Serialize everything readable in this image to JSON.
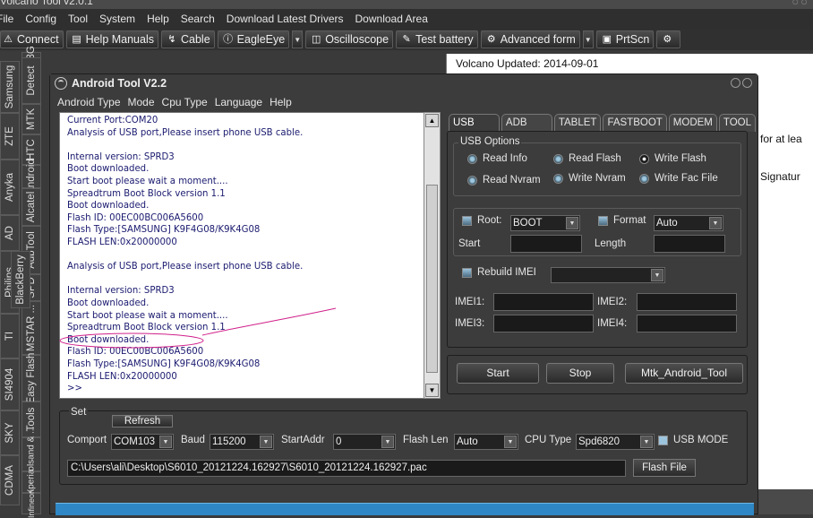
{
  "outer_window": {
    "title": "Volcano Tool v2.0.1",
    "menu": [
      "File",
      "Config",
      "Tool",
      "System",
      "Help",
      "Search",
      "Download Latest Drivers",
      "Download Area"
    ],
    "toolbar": {
      "connect": "Connect",
      "help_manuals": "Help Manuals",
      "cable": "Cable",
      "eagleeye": "EagleEye",
      "oscilloscope": "Oscilloscope",
      "test_battery": "Test battery",
      "advanced_form": "Advanced form",
      "prtscn": "PrtScn"
    },
    "left_tabs_col1": [
      "Samsung",
      "ZTE",
      "Anyka",
      "AD",
      "Philips",
      "TI",
      "SI4904",
      "SKY",
      "CDMA"
    ],
    "left_tabs_col2": [
      "AD_3G",
      "Detect",
      "MTK",
      "HTC",
      "Android",
      "Alcatel",
      "AdbTool",
      "BlackBerry",
      "SPD",
      "MSTAR ...",
      "Easy Flash",
      "Tools",
      "Coolsand & ...",
      "Xperia",
      "Infineon"
    ],
    "log_lines": [
      "Volcano Updated: 2014-09-01",
      "for at lea",
      "Signatur"
    ]
  },
  "dialog": {
    "title": "Android Tool V2.2",
    "menu": [
      "Android Type",
      "Mode",
      "Cpu Type",
      "Language",
      "Help"
    ],
    "log": [
      "Current Port:COM20",
      "Analysis of USB port,Please insert phone USB cable.",
      "",
      "Internal version: SPRD3",
      "Boot downloaded.",
      "Start boot please wait a moment....",
      "Spreadtrum Boot Block version 1.1",
      "Boot downloaded.",
      "Flash ID: 00EC00BC006A5600",
      "Flash Type:[SAMSUNG] K9F4G08/K9K4G08",
      "FLASH LEN:0x20000000",
      "",
      "Analysis of USB port,Please insert phone USB cable.",
      "",
      "Internal version: SPRD3",
      "Boot downloaded.",
      "Start boot please wait a moment....",
      "Spreadtrum Boot Block version 1.1",
      "Boot downloaded.",
      "Flash ID: 00EC00BC006A5600",
      "Flash Type:[SAMSUNG] K9F4G08/K9K4G08",
      "FLASH LEN:0x20000000",
      ">>"
    ],
    "tabs": [
      "USB MODE",
      "ADB MODE",
      "TABLET",
      "FASTBOOT",
      "MODEM",
      "TOOL"
    ],
    "usb_options": {
      "label": "USB Options",
      "read_info": "Read Info",
      "read_flash": "Read Flash",
      "write_flash": "Write Flash",
      "read_nvram": "Read Nvram",
      "write_nvram": "Write Nvram",
      "write_fac_file": "Write Fac File"
    },
    "root_label": "Root:",
    "root_value": "BOOT",
    "format_label": "Format",
    "format_value": "Auto",
    "start_label": "Start",
    "length_label": "Length",
    "rebuild_imei": "Rebuild IMEI",
    "imei1": "IMEI1:",
    "imei2": "IMEI2:",
    "imei3": "IMEI3:",
    "imei4": "IMEI4:",
    "btn_start": "Start",
    "btn_stop": "Stop",
    "btn_mtk": "Mtk_Android_Tool",
    "set": {
      "label": "Set",
      "refresh": "Refresh",
      "comport_label": "Comport",
      "comport_value": "COM103",
      "baud_label": "Baud",
      "baud_value": "115200",
      "startaddr_label": "StartAddr",
      "startaddr_value": "0",
      "flashlen_label": "Flash Len",
      "flashlen_value": "Auto",
      "cputype_label": "CPU Type",
      "cputype_value": "Spd6820",
      "usb_mode": "USB MODE",
      "file_path": "C:\\Users\\ali\\Desktop\\S6010_20121224.162927\\S6010_20121224.162927.pac",
      "flash_file": "Flash File"
    }
  },
  "colors": {
    "dialog_bg": "#3c3c3c",
    "log_text": "#1a1a70",
    "annotation": "#d0208a",
    "bottom_bar": "#2f87c5"
  }
}
